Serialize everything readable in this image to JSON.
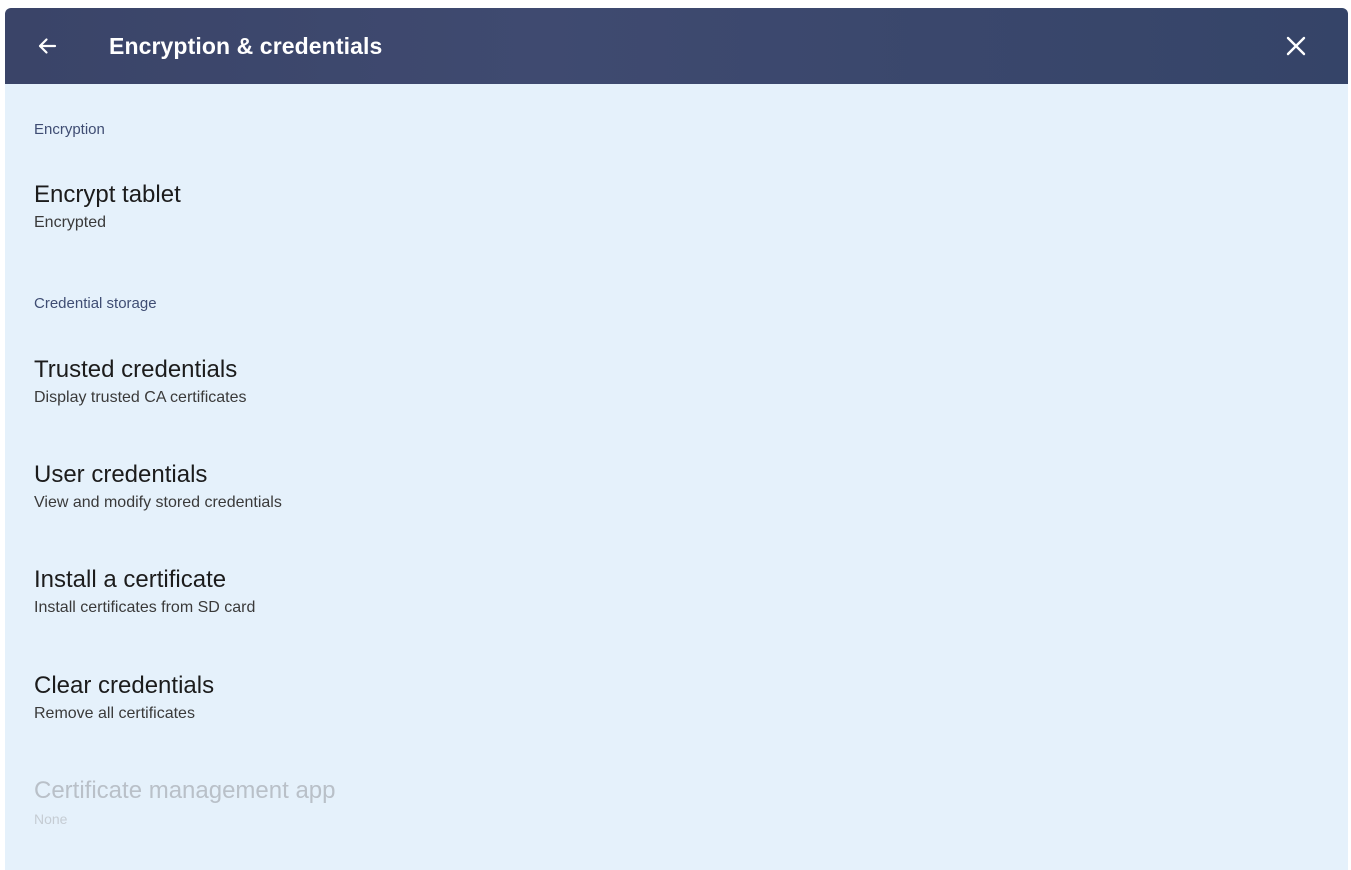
{
  "header": {
    "title": "Encryption & credentials",
    "back_icon": "arrow-left-icon",
    "close_icon": "close-icon",
    "background": "#3b466c",
    "title_color": "#ffffff"
  },
  "background": "#e5f1fb",
  "sections": {
    "encryption": {
      "label": "Encryption",
      "items": [
        {
          "title": "Encrypt tablet",
          "subtitle": "Encrypted",
          "enabled": true
        }
      ]
    },
    "credential_storage": {
      "label": "Credential storage",
      "items": [
        {
          "title": "Trusted credentials",
          "subtitle": "Display trusted CA certificates",
          "enabled": true
        },
        {
          "title": "User credentials",
          "subtitle": "View and modify stored credentials",
          "enabled": true
        },
        {
          "title": "Install a certificate",
          "subtitle": "Install certificates from SD card",
          "enabled": true
        },
        {
          "title": "Clear credentials",
          "subtitle": "Remove all certificates",
          "enabled": true
        },
        {
          "title": "Certificate management app",
          "subtitle": "None",
          "enabled": false
        }
      ]
    }
  }
}
